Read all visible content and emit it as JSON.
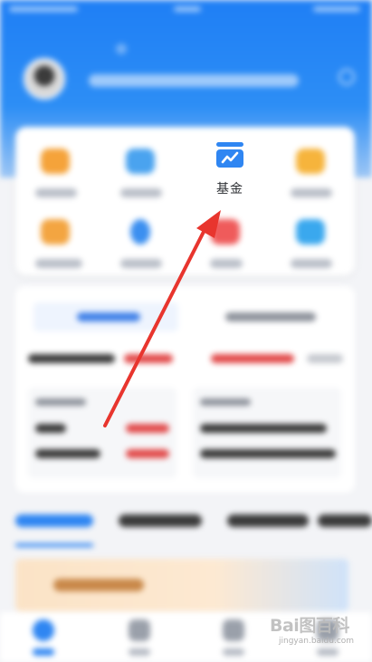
{
  "fund_shortcut": {
    "label": "基金"
  },
  "colors": {
    "brand_blue": "#2f86f2",
    "arrow_red": "#e8352e",
    "fund_icon_blue": "#2f86f2"
  },
  "watermark": {
    "logo": "Bai图百科",
    "url": "jingyan.baidu.com"
  },
  "icons": {
    "fund": "fund-chart-icon",
    "search": "search-icon",
    "annotation": "red-arrow-icon"
  }
}
